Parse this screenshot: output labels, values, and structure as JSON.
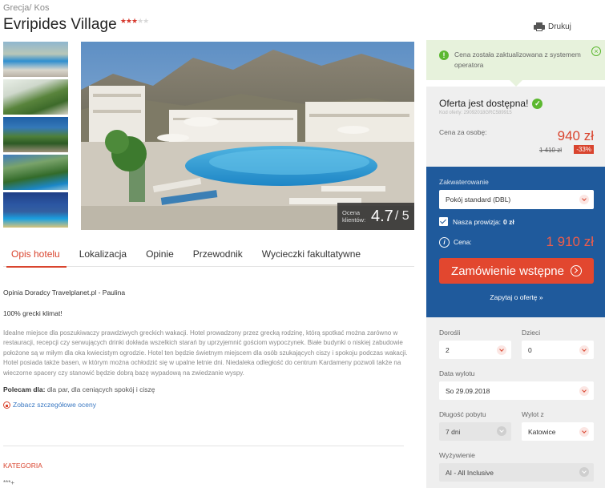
{
  "breadcrumb": {
    "country": "Grecja",
    "separator": "/",
    "region": "Kos"
  },
  "hotel": {
    "name": "Evripides Village",
    "stars_filled": 3,
    "stars_total": 5
  },
  "print_label": "Drukuj",
  "rating": {
    "label": "Ocena klientów:",
    "value": "4.7",
    "max": "/ 5"
  },
  "tabs": [
    {
      "label": "Opis hotelu"
    },
    {
      "label": "Lokalizacja"
    },
    {
      "label": "Opinie"
    },
    {
      "label": "Przewodnik"
    },
    {
      "label": "Wycieczki fakultatywne"
    }
  ],
  "content": {
    "advisor": "Opinia Doradcy Travelplanet.pl - Paulina",
    "subhead": "100% grecki klimat!",
    "description": "Idealne miejsce dla poszukiwaczy prawdziwych greckich wakacji. Hotel prowadzony przez grecką rodzinę, którą spotkać można zarówno w restauracji, recepcji czy serwujących drinki dokłada wszelkich starań by uprzyjemnić gościom wypoczynek. Białe budynki o niskiej zabudowie położone są w miłym dla oka kwiecistym ogrodzie. Hotel ten będzie świetnym miejscem dla osób szukających ciszy i spokoju podczas wakacji. Hotel posiada także basen, w którym można ochłodzić się w upalne letnie dni. Niedaleka odległość do centrum Kardameny pozwoli także na wieczorne spacery czy stanowić będzie dobrą bazę wypadową na zwiedzanie wyspy.",
    "recommend_label": "Polecam dla:",
    "recommend_value": "dla par, dla ceniących spokój i ciszę",
    "rates_link": "Zobacz szczegółowe oceny",
    "category_label": "KATEGORIA",
    "category_value": "***+"
  },
  "notice": {
    "text": "Cena została zaktualizowana z systemem operatora"
  },
  "offer": {
    "title": "Oferta jest dostępna!",
    "code": "Kod oferty: 29092018GRC589915",
    "per_person_label": "Cena za osobę:",
    "price": "940 zł",
    "old_price": "1 410 zł",
    "discount": "-33%"
  },
  "booking": {
    "accommodation_label": "Zakwaterowanie",
    "accommodation_value": "Pokój standard (DBL)",
    "commission_label": "Nasza prowizja:",
    "commission_value": "0 zł",
    "price_label": "Cena:",
    "price_total": "1 910 zł",
    "order_button": "Zamówienie wstępne",
    "ask_link": "Zapytaj o ofertę »"
  },
  "filters": {
    "adults_label": "Dorośli",
    "adults_value": "2",
    "children_label": "Dzieci",
    "children_value": "0",
    "departure_date_label": "Data wylotu",
    "departure_date_value": "So 29.09.2018",
    "length_label": "Długość pobytu",
    "length_value": "7 dni",
    "from_label": "Wylot z",
    "from_value": "Katowice",
    "board_label": "Wyżywienie",
    "board_value": "AI - All Inclusive"
  },
  "colors": {
    "accent": "#d9442e",
    "booking_bg": "#1f5a9c",
    "success": "#5cb830"
  }
}
